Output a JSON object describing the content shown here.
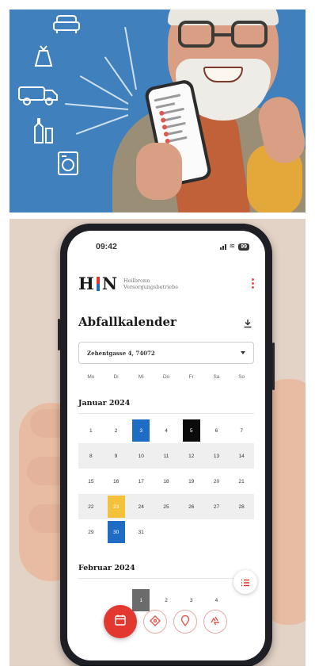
{
  "phone": {
    "status_time": "09:42",
    "battery": "99",
    "logo": {
      "left": "H",
      "right": "N",
      "line1": "Heilbronn",
      "line2": "Versorgungsbetriebe",
      "bar_colors": [
        "#e2382f",
        "#1e6cc4"
      ]
    },
    "title": "Abfallkalender",
    "address": "Zehentgasse 4, 74072",
    "weekdays": [
      "Mo",
      "Di",
      "Mi",
      "Do",
      "Fr",
      "Sa",
      "So"
    ],
    "months": {
      "january": "Januar 2024",
      "february": "Februar 2024"
    },
    "january_weeks": [
      [
        "1",
        "2",
        "3",
        "4",
        "5",
        "6",
        "7"
      ],
      [
        "8",
        "9",
        "10",
        "11",
        "12",
        "13",
        "14"
      ],
      [
        "15",
        "16",
        "17",
        "18",
        "19",
        "20",
        "21"
      ],
      [
        "22",
        "23",
        "24",
        "25",
        "26",
        "27",
        "28"
      ],
      [
        "29",
        "30",
        "31",
        "",
        "",
        "",
        ""
      ]
    ],
    "february_partial": [
      "",
      "",
      "1",
      "2",
      "3",
      "4",
      ""
    ],
    "highlight_colors": {
      "blue": "#1e6cc4",
      "black": "#0b0b0b",
      "yellow": "#f3c23a",
      "red": "#e2382f"
    },
    "icons": {
      "menu": "kebab-menu-icon",
      "download": "download-icon",
      "dropdown": "chevron-down-icon",
      "list": "list-icon",
      "calendar": "calendar-icon",
      "tag": "tag-icon",
      "location": "location-pin-icon",
      "recycle": "recycle-icon"
    }
  }
}
